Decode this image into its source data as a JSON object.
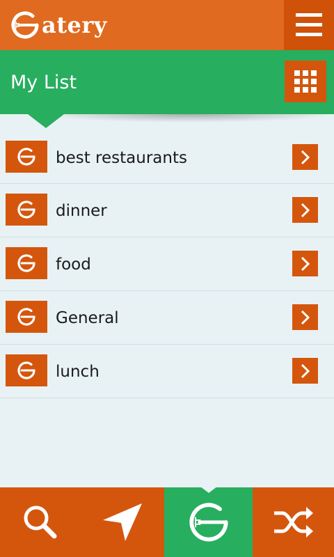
{
  "app": {
    "logo_text": "atery",
    "logo_icon": "eatery-e-fork-icon",
    "menu_icon": "hamburger-menu-icon"
  },
  "header": {
    "title": "My List",
    "grid_icon": "grid-view-icon"
  },
  "list": {
    "items": [
      {
        "label": "best restaurants",
        "icon": "eatery-e-icon",
        "action_icon": "chevron-right-icon"
      },
      {
        "label": "dinner",
        "icon": "eatery-e-icon",
        "action_icon": "chevron-right-icon"
      },
      {
        "label": "food",
        "icon": "eatery-e-icon",
        "action_icon": "chevron-right-icon"
      },
      {
        "label": "General",
        "icon": "eatery-e-icon",
        "action_icon": "chevron-right-icon"
      },
      {
        "label": "lunch",
        "icon": "eatery-e-icon",
        "action_icon": "chevron-right-icon"
      }
    ]
  },
  "bottom_nav": {
    "tabs": [
      {
        "icon": "search-icon",
        "active": false
      },
      {
        "icon": "navigation-arrow-icon",
        "active": false
      },
      {
        "icon": "eatery-e-fork-icon",
        "active": true
      },
      {
        "icon": "shuffle-icon",
        "active": false
      }
    ]
  },
  "colors": {
    "brand_orange": "#e06a1f",
    "dark_orange": "#d4560d",
    "green": "#27ae5f",
    "background": "#e8f2f5"
  }
}
